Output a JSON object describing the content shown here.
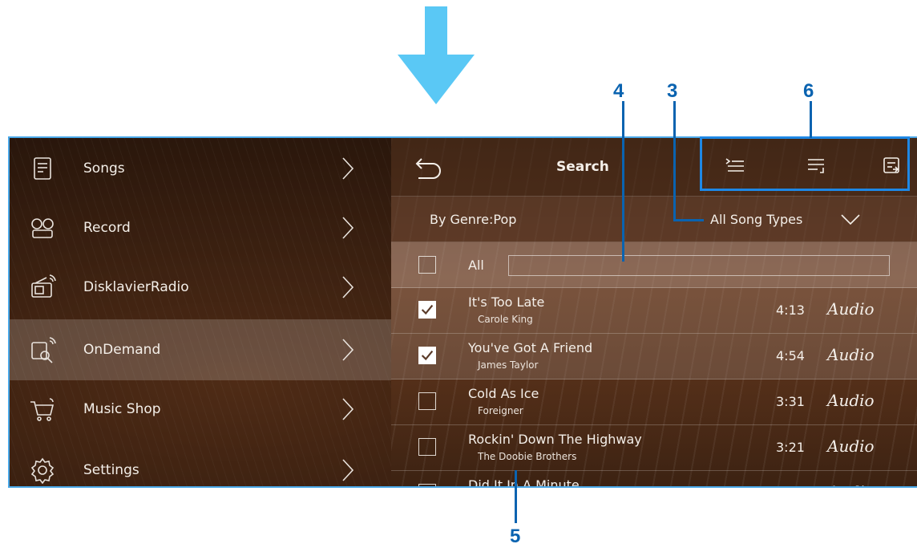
{
  "callouts": {
    "c4": "4",
    "c3": "3",
    "c6": "6",
    "c5": "5"
  },
  "colors": {
    "accent": "#1e88e5",
    "arrow": "#5ac8f5",
    "callout_text": "#0a63b0"
  },
  "sidebar": {
    "items": [
      {
        "label": "Songs",
        "icon": "songs-icon"
      },
      {
        "label": "Record",
        "icon": "record-icon"
      },
      {
        "label": "DisklavierRadio",
        "icon": "radio-icon"
      },
      {
        "label": "OnDemand",
        "icon": "ondemand-icon",
        "active": true
      },
      {
        "label": "Music Shop",
        "icon": "music-shop-icon"
      },
      {
        "label": "Settings",
        "icon": "settings-icon"
      }
    ]
  },
  "header": {
    "title": "Search",
    "back_icon": "back-icon",
    "tools": [
      "add-to-queue-icon",
      "play-next-icon",
      "export-list-icon"
    ]
  },
  "filter": {
    "genre_label": "By Genre:Pop",
    "song_type": "All Song Types"
  },
  "select_all": {
    "label": "All"
  },
  "songs": [
    {
      "title": "It's Too Late",
      "artist": "Carole King",
      "time": "4:13",
      "type": "Audio",
      "checked": true
    },
    {
      "title": "You've Got A Friend",
      "artist": "James Taylor",
      "time": "4:54",
      "type": "Audio",
      "checked": true
    },
    {
      "title": "Cold As Ice",
      "artist": "Foreigner",
      "time": "3:31",
      "type": "Audio",
      "checked": false
    },
    {
      "title": "Rockin' Down The Highway",
      "artist": "The Doobie Brothers",
      "time": "3:21",
      "type": "Audio",
      "checked": false
    },
    {
      "title": "Did It In A Minute",
      "artist": "",
      "time": "",
      "type": "Audio",
      "checked": false
    }
  ]
}
